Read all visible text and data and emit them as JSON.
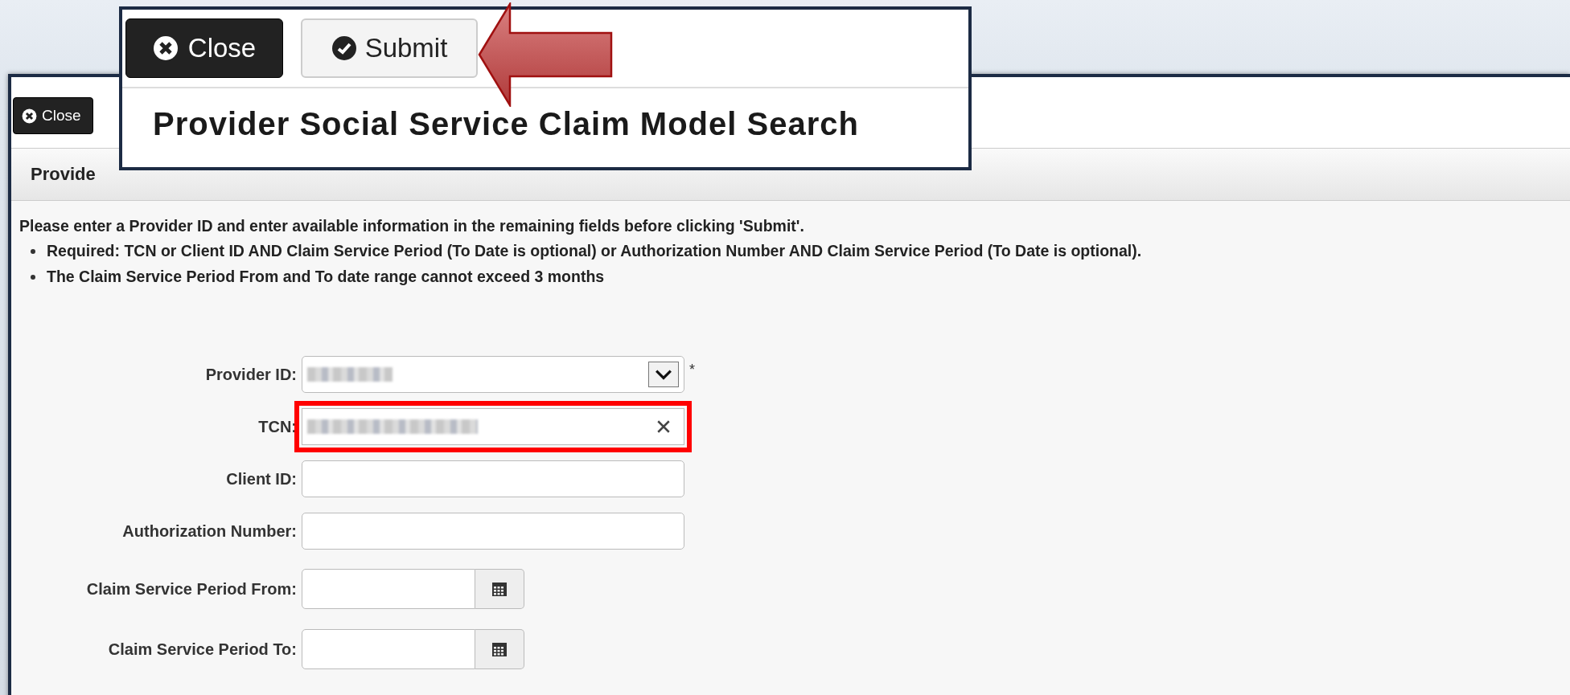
{
  "window": {
    "toolbar": {
      "close_button": "Close"
    },
    "header": {
      "title": "Provide"
    },
    "instructions": {
      "intro": "Please enter a Provider ID and enter available information in the remaining fields before clicking 'Submit'.",
      "bullets": [
        "Required: TCN or Client ID AND Claim Service Period (To Date is optional) or Authorization Number AND Claim Service Period (To Date is optional).",
        "The Claim Service Period From and To date range cannot exceed 3 months"
      ]
    },
    "form": [
      {
        "kind": "select",
        "label": "Provider ID:",
        "value_blurred": true,
        "required": true,
        "highlighted": false
      },
      {
        "kind": "clearable",
        "label": "TCN:",
        "value_blurred": true,
        "required": false,
        "highlighted": true
      },
      {
        "kind": "text",
        "label": "Client ID:",
        "value_blurred": false,
        "required": false,
        "highlighted": false
      },
      {
        "kind": "text",
        "label": "Authorization Number:",
        "value_blurred": false,
        "required": false,
        "highlighted": false
      },
      {
        "kind": "date",
        "label": "Claim Service Period From:",
        "value_blurred": false,
        "required": false,
        "highlighted": false
      },
      {
        "kind": "date",
        "label": "Claim Service Period To:",
        "value_blurred": false,
        "required": false,
        "highlighted": false
      }
    ]
  },
  "callout": {
    "close_button": "Close",
    "submit_button": "Submit",
    "title": "Provider Social Service Claim Model Search",
    "arrow": true
  },
  "required_mark": "*"
}
